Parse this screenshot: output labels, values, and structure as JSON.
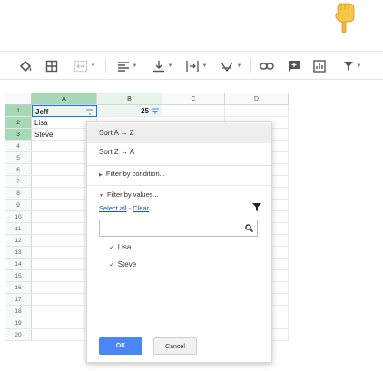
{
  "toolbar": {
    "tools": [
      {
        "name": "fill-color-icon"
      },
      {
        "name": "borders-icon"
      },
      {
        "name": "merge-cells-icon"
      },
      {
        "name": "horizontal-align-icon"
      },
      {
        "name": "vertical-align-icon"
      },
      {
        "name": "text-wrapping-icon"
      },
      {
        "name": "text-rotation-icon"
      },
      {
        "name": "insert-link-icon"
      },
      {
        "name": "insert-comment-icon"
      },
      {
        "name": "insert-chart-icon"
      },
      {
        "name": "filter-icon"
      }
    ]
  },
  "grid": {
    "columns": [
      "A",
      "B",
      "C",
      "D"
    ],
    "rows": [
      "1",
      "2",
      "3",
      "4",
      "5",
      "6",
      "7",
      "8",
      "9",
      "10",
      "11",
      "12",
      "13",
      "14",
      "15",
      "16",
      "17",
      "18",
      "19",
      "20"
    ],
    "cells": {
      "a1": "Jeff",
      "b1": "25",
      "a2": "Lisa",
      "a3": "Steve"
    }
  },
  "menu": {
    "sort_az": "Sort A → Z",
    "sort_za": "Sort Z → A",
    "filter_condition": "Filter by condition...",
    "filter_values": "Filter by values...",
    "select_all": "Select all",
    "separator": " - ",
    "clear": "Clear",
    "search_value": "",
    "values": [
      "Lisa",
      "Steve"
    ],
    "ok_label": "OK",
    "cancel_label": "Cancel"
  },
  "colors": {
    "selected_header": "#a7d9b7",
    "ok_button": "#4a86f5",
    "link": "#1155cc"
  }
}
